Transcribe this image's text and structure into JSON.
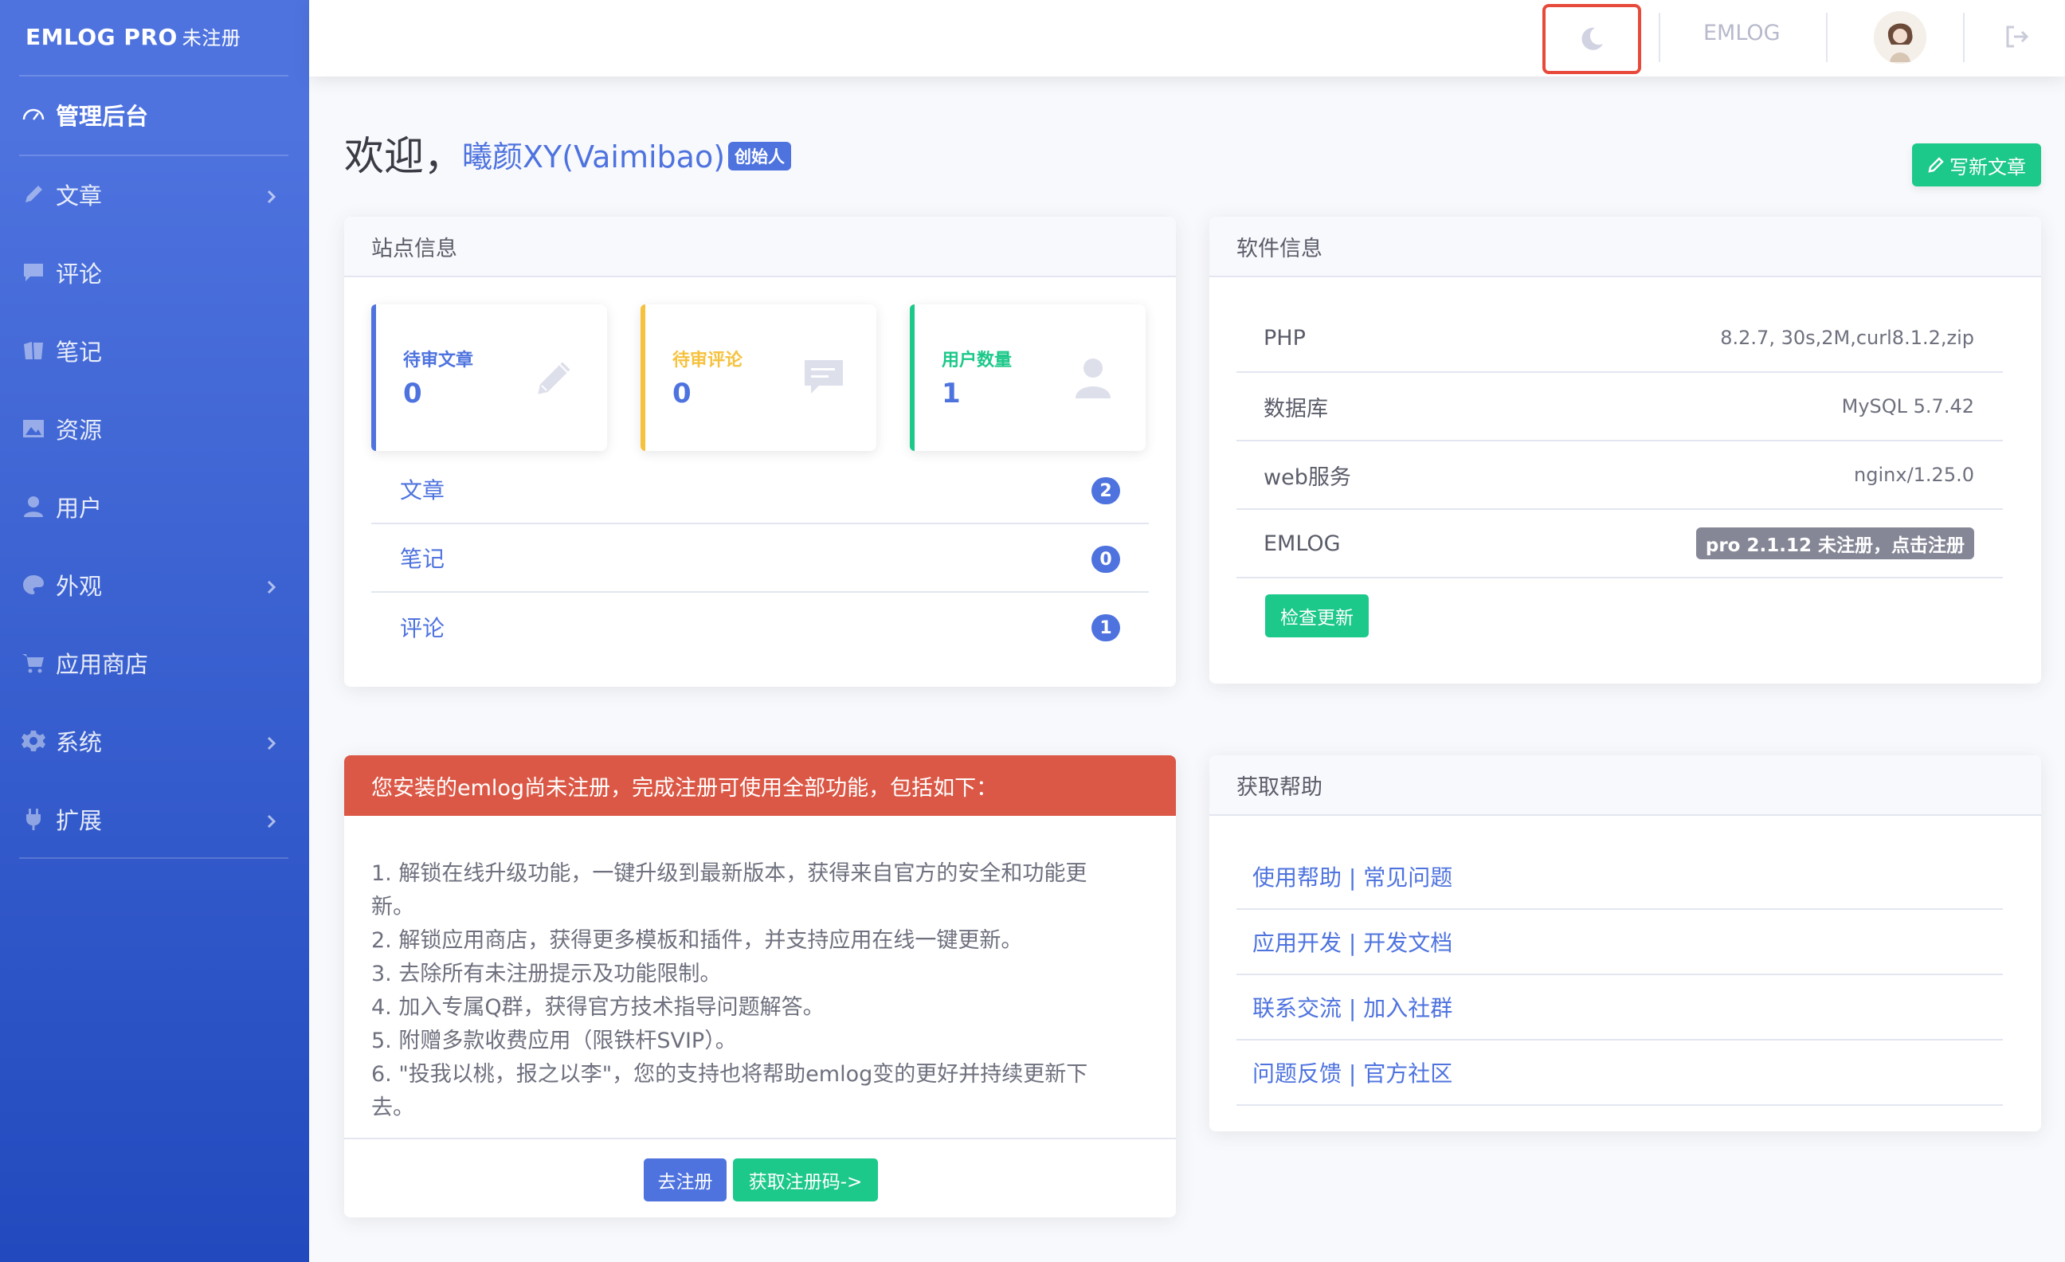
{
  "sidebar": {
    "brand": "EMLOG PRO",
    "brand_sub": "未注册",
    "items": [
      {
        "label": "管理后台",
        "icon": "dashboard-icon",
        "active": true,
        "has_children": false
      },
      {
        "label": "文章",
        "icon": "pencil-icon",
        "has_children": true
      },
      {
        "label": "评论",
        "icon": "comment-icon",
        "has_children": false
      },
      {
        "label": "笔记",
        "icon": "note-icon",
        "has_children": false
      },
      {
        "label": "资源",
        "icon": "image-icon",
        "has_children": false
      },
      {
        "label": "用户",
        "icon": "user-icon",
        "has_children": false
      },
      {
        "label": "外观",
        "icon": "palette-icon",
        "has_children": true
      },
      {
        "label": "应用商店",
        "icon": "cart-icon",
        "has_children": false
      },
      {
        "label": "系统",
        "icon": "gear-icon",
        "has_children": true
      },
      {
        "label": "扩展",
        "icon": "plug-icon",
        "has_children": true
      }
    ]
  },
  "topbar": {
    "site_label": "EMLOG",
    "dark_mode_icon": "moon-icon",
    "logout_icon": "logout-icon"
  },
  "welcome": {
    "greeting": "欢迎，",
    "name": "曦颜XY(Vaimibao)",
    "role": "创始人",
    "new_post": "写新文章"
  },
  "site_info": {
    "title": "站点信息",
    "stats": [
      {
        "label": "待审文章",
        "value": "0",
        "color": "#4e73df",
        "icon": "pencil-icon"
      },
      {
        "label": "待审评论",
        "value": "0",
        "color": "#f6c23e",
        "icon": "comment-icon"
      },
      {
        "label": "用户数量",
        "value": "1",
        "color": "#1cc88a",
        "icon": "user-icon"
      }
    ],
    "counts": [
      {
        "label": "文章",
        "count": "2"
      },
      {
        "label": "笔记",
        "count": "0"
      },
      {
        "label": "评论",
        "count": "1"
      }
    ]
  },
  "software_info": {
    "title": "软件信息",
    "rows": [
      {
        "key": "PHP",
        "value": "8.2.7, 30s,2M,curl8.1.2,zip"
      },
      {
        "key": "数据库",
        "value": "MySQL 5.7.42"
      },
      {
        "key": "web服务",
        "value": "nginx/1.25.0"
      },
      {
        "key": "EMLOG",
        "value": "pro 2.1.12 未注册，点击注册"
      }
    ],
    "check_update": "检查更新"
  },
  "register": {
    "title": "您安装的emlog尚未注册，完成注册可使用全部功能，包括如下：",
    "lines": [
      "1. 解锁在线升级功能，一键升级到最新版本，获得来自官方的安全和功能更新。",
      "2. 解锁应用商店，获得更多模板和插件，并支持应用在线一键更新。",
      "3. 去除所有未注册提示及功能限制。",
      "4. 加入专属Q群，获得官方技术指导问题解答。",
      "5. 附赠多款收费应用（限铁杆SVIP）。",
      "6. \"投我以桃，报之以李\"，您的支持也将帮助emlog变的更好并持续更新下去。"
    ],
    "btn_register": "去注册",
    "btn_get_code": "获取注册码->"
  },
  "help": {
    "title": "获取帮助",
    "links": [
      "使用帮助 | 常见问题",
      "应用开发 | 开发文档",
      "联系交流 | 加入社群",
      "问题反馈 | 官方社区"
    ]
  }
}
